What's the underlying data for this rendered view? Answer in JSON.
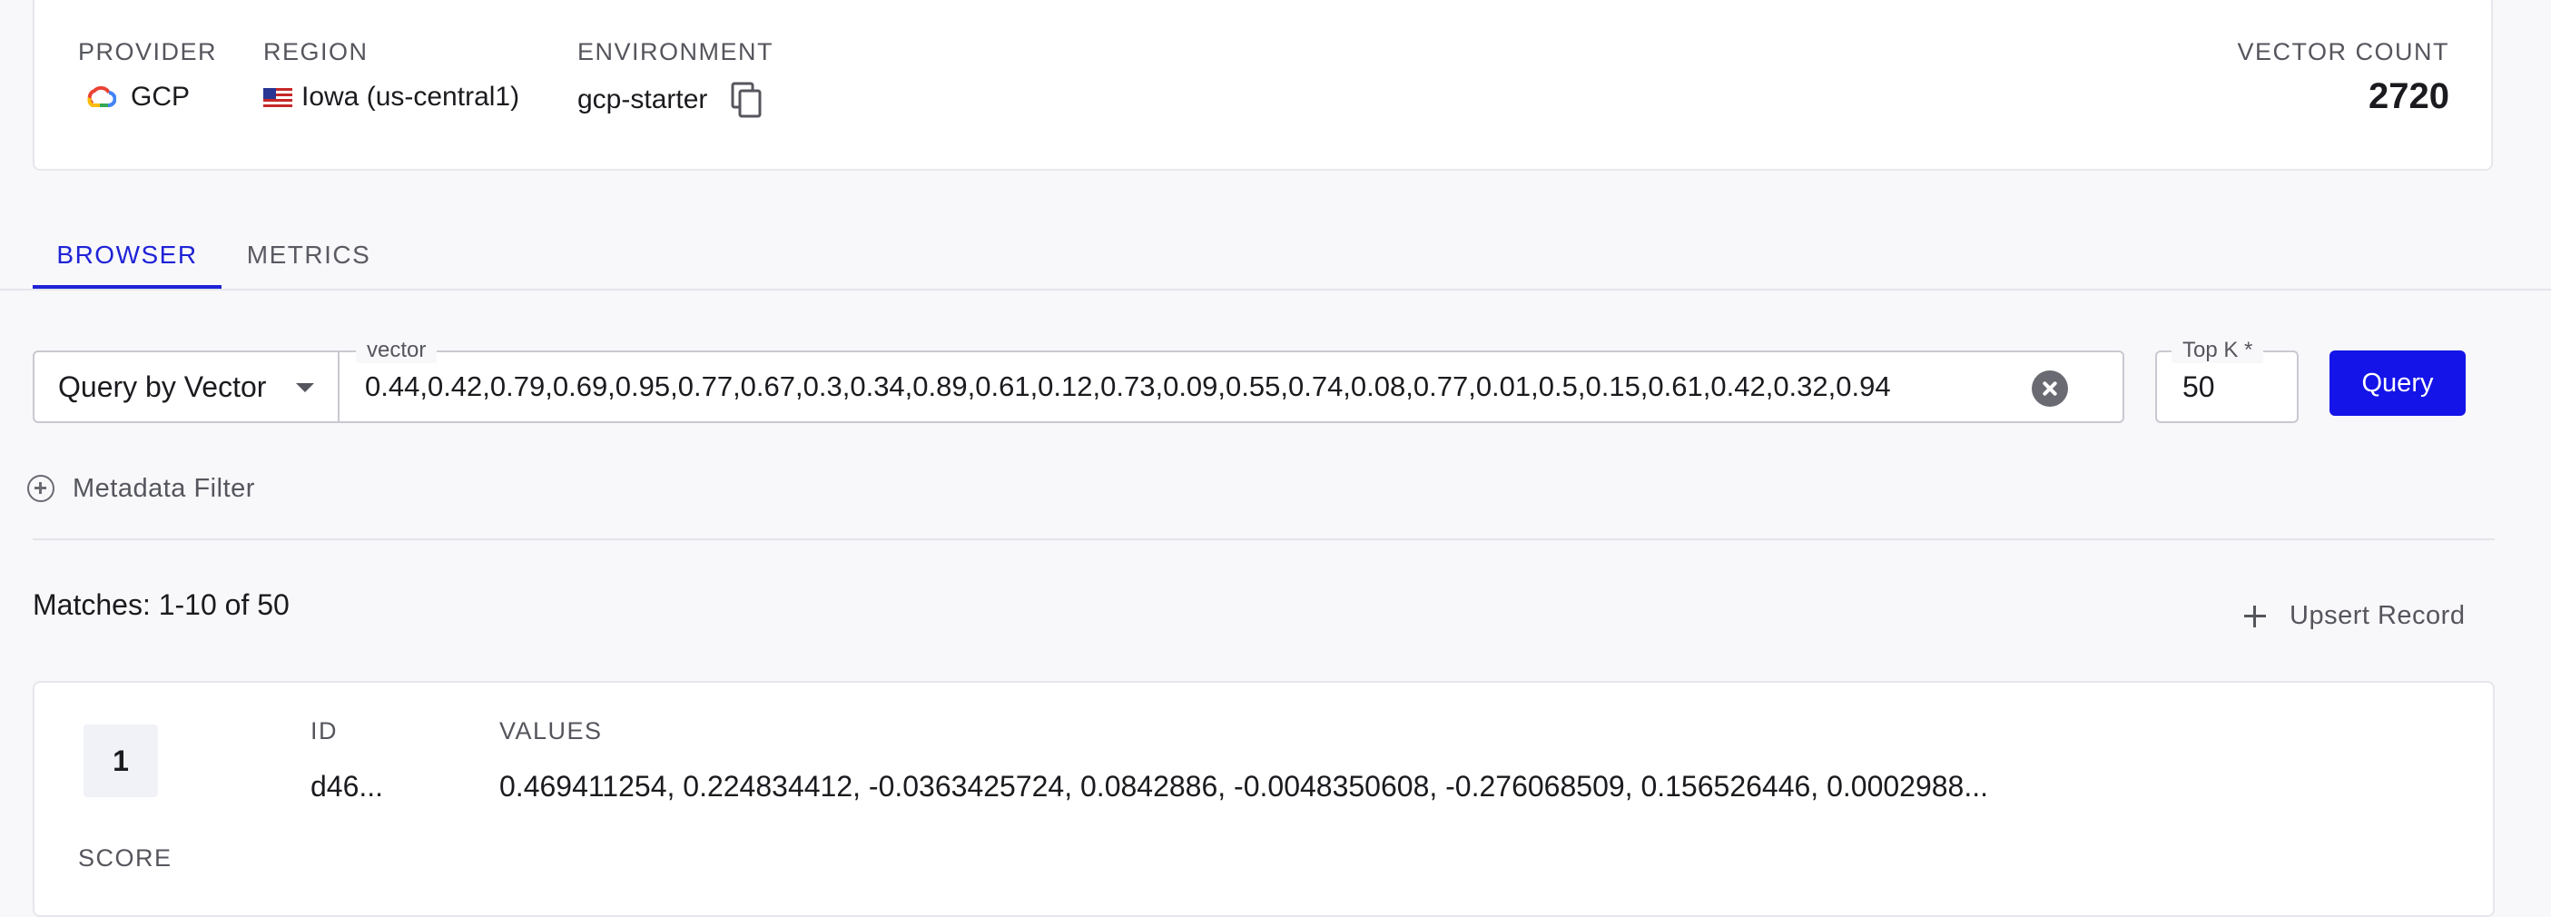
{
  "index_info": {
    "provider": {
      "label": "PROVIDER",
      "value": "GCP",
      "icon": "google-cloud-icon"
    },
    "region": {
      "label": "REGION",
      "value": "Iowa (us-central1)",
      "icon": "us-flag-icon"
    },
    "environment": {
      "label": "ENVIRONMENT",
      "value": "gcp-starter",
      "icon": "copy-icon"
    },
    "vector_count": {
      "label": "VECTOR COUNT",
      "value": "2720"
    }
  },
  "tabs": [
    {
      "label": "BROWSER",
      "active": true
    },
    {
      "label": "METRICS",
      "active": false
    }
  ],
  "query": {
    "type_label": "Query by Vector",
    "vector_legend": "vector",
    "vector_value": "0.44,0.42,0.79,0.69,0.95,0.77,0.67,0.3,0.34,0.89,0.61,0.12,0.73,0.09,0.55,0.74,0.08,0.77,0.01,0.5,0.15,0.61,0.42,0.32,0.94",
    "topk_legend": "Top K *",
    "topk_value": "50",
    "submit_label": "Query"
  },
  "metadata_filter_label": "Metadata Filter",
  "results": {
    "matches_label": "Matches: 1-10 of 50",
    "upsert_label": "Upsert Record",
    "items": [
      {
        "rank": "1",
        "id_label": "ID",
        "id": "d46...",
        "values_label": "VALUES",
        "values": "0.469411254, 0.224834412, -0.0363425724, 0.0842886, -0.0048350608, -0.276068509, 0.156526446, 0.0002988...",
        "score_label": "SCORE"
      }
    ]
  },
  "colors": {
    "accent": "#1f23d6",
    "button": "#1414e8",
    "background": "#f8f8fb"
  }
}
